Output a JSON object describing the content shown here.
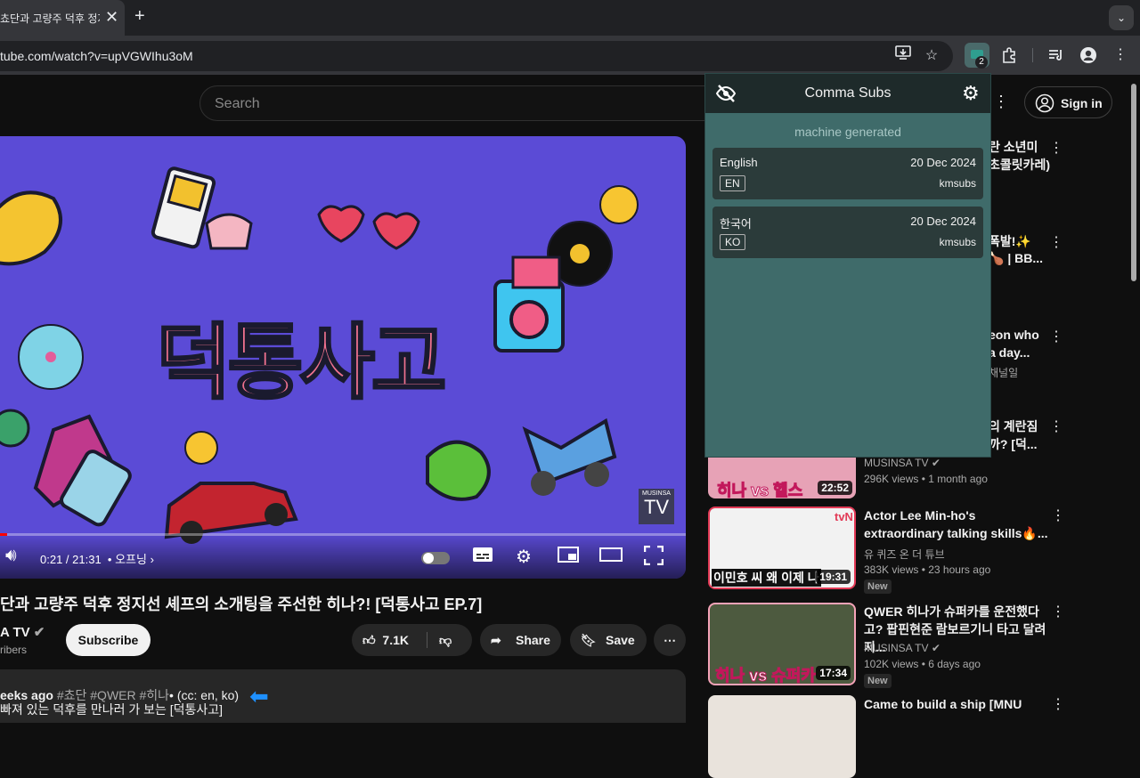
{
  "browser": {
    "tab_title": "쵸단과 고량주 덕후 정지",
    "url": "tube.com/watch?v=upVGWIhu3oM",
    "extension_badge": "2"
  },
  "youtube": {
    "search_placeholder": "Search",
    "sign_in": "Sign in"
  },
  "video": {
    "time": "0:21 / 21:31",
    "chapter": "• 오프닝",
    "logo_title": "덕통사고",
    "watermark_top": "MUSINSA",
    "watermark_bottom": "TV",
    "title": "단과 고량주 덕후 정지선 셰프의 소개팅을 주선한 히나?! [덕통사고 EP.7]",
    "channel": "A TV",
    "subscribers": "ribers",
    "subscribe": "Subscribe",
    "likes": "7.1K",
    "share": "Share",
    "save": "Save",
    "desc_line1_prefix": "eeks ago",
    "desc_line1_tags": "#쵸단 #QWER #히나",
    "desc_line1_suffix": "• (cc: en, ko)",
    "desc_line2": "빠져 있는 덕후를 만나러 가 보는 [덕통사고]"
  },
  "popup": {
    "title": "Comma Subs",
    "section": "machine generated",
    "subtitles": [
      {
        "language": "English",
        "date": "20 Dec 2024",
        "code": "EN",
        "source": "kmsubs"
      },
      {
        "language": "한국어",
        "date": "20 Dec 2024",
        "code": "KO",
        "source": "kmsubs"
      }
    ]
  },
  "partial_titles": [
    "란 소년미",
    "초콜릿카레)",
    "폭발!✨",
    "🍗 | BB...",
    "eon who",
    "a day...",
    "채널일",
    "의 계란짐",
    "까? [덕..."
  ],
  "recommendations": [
    {
      "title": "",
      "channel": "MUSINSA TV",
      "meta": "296K views • 1 month ago",
      "duration": "22:52",
      "thumb_text": "히나 vs 헬스",
      "is_new": ""
    },
    {
      "title": "Actor Lee Min-ho's extraordinary talking skills🔥...",
      "channel": "유 퀴즈 온 더 튜브",
      "meta": "383K views • 23 hours ago",
      "duration": "19:31",
      "thumb_text": "이민호 씨 왜 이제 나",
      "is_new": "New"
    },
    {
      "title": "QWER 히나가 슈퍼카를 운전했다고? 팝핀현준 람보르기니 타고 달려 지...",
      "channel": "MUSINSA TV",
      "meta": "102K views • 6 days ago",
      "duration": "17:34",
      "thumb_text": "히나 vs 슈퍼카",
      "is_new": "New"
    },
    {
      "title": "Came to build a ship [MNU",
      "channel": "",
      "meta": "",
      "duration": "",
      "thumb_text": "",
      "is_new": ""
    }
  ]
}
